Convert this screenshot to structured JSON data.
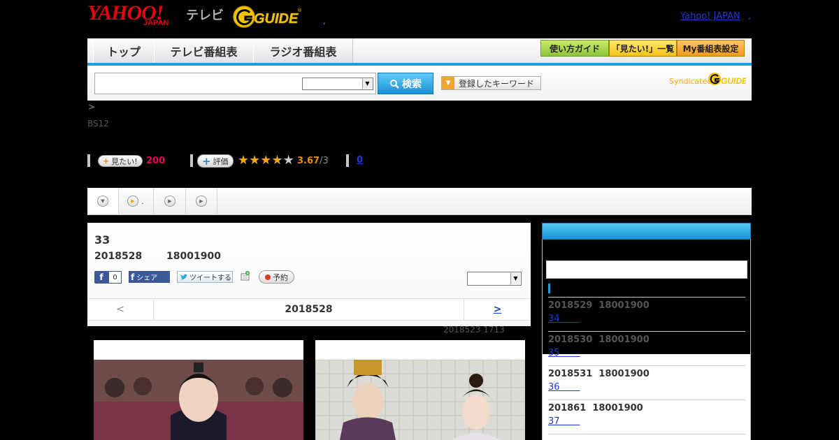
{
  "header": {
    "brand_yahoo": "YAHOO!",
    "brand_japan": "JAPAN",
    "brand_tv": "テレビ",
    "brand_gguide": "G-GUIDE",
    "sep_dot": ",",
    "yahoo_japan_link": "Yahoo! JAPAN",
    "yahoo_dot": ","
  },
  "nav": {
    "tabs": [
      "トップ",
      "テレビ番組表",
      "ラジオ番組表"
    ],
    "buttons": [
      "使い方ガイド",
      "「見たい!」一覧",
      "My番組表設定"
    ]
  },
  "search": {
    "input_value": "",
    "select_value": "",
    "button_label": "検索",
    "keyword_button": "登録したキーワード",
    "syndicated_label": "Syndicated"
  },
  "info": {
    "breadcrumb": ">",
    "channel": "BS12",
    "want_label": "見たい!",
    "want_count": "200",
    "rate_label": "評価",
    "rating_value": "3.67",
    "rating_suffix": "/3",
    "rating_stars": 3.67,
    "zero_link": "0"
  },
  "tabs": {
    "second_tab_suffix": "."
  },
  "episode": {
    "title": "33",
    "date": "2018528",
    "time": "18001900",
    "fb_count": "0",
    "share_label": "シェア",
    "tweet_label": "ツイートする",
    "reserve_label": "予約",
    "pager_prev": "<",
    "pager_date": "2018528",
    "pager_next": ">",
    "updated": "2018523  1713"
  },
  "sidebar": {
    "items": [
      {
        "date": "2018529",
        "time": "18001900",
        "link": "34       "
      },
      {
        "date": "2018530",
        "time": "18001900",
        "link": "35       "
      },
      {
        "date": "2018531",
        "time": "18001900",
        "link": "36       "
      },
      {
        "date": "201861",
        "time": "18001900",
        "link": "37       "
      }
    ]
  },
  "colors": {
    "accent": "#16a0dc",
    "brand_red": "#e60012",
    "want_pink": "#e5005a",
    "rating_orange": "#e68a00"
  }
}
